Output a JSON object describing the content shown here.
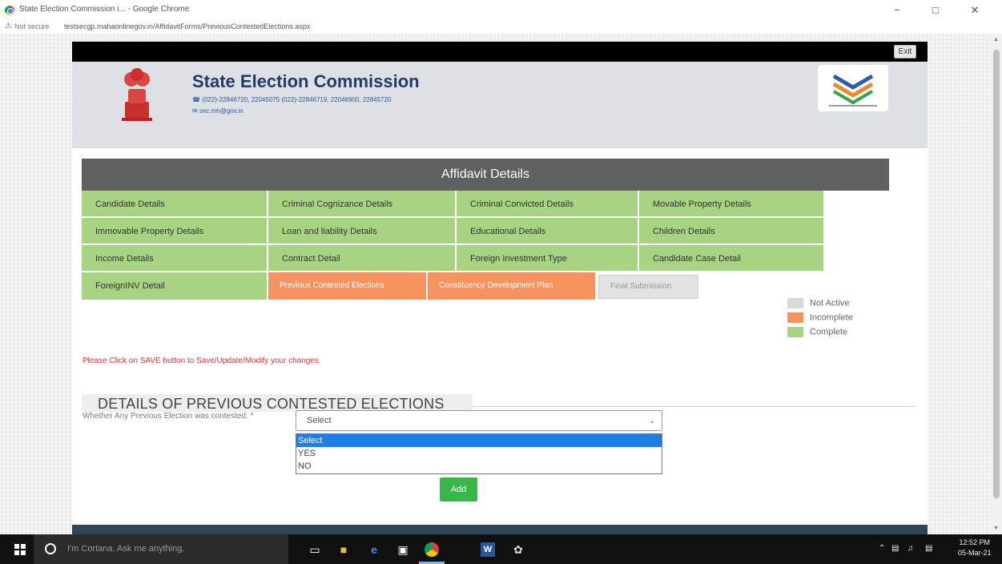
{
  "browser": {
    "window_title": "State Election Commission i... - Google Chrome",
    "not_secure": "Not secure",
    "url": "testsecgp.mahaonlinegov.in/AffidavitForms/PreviousContestedElections.aspx",
    "minimize": "−",
    "maximize": "□",
    "close": "✕"
  },
  "header": {
    "exit_label": "Exit",
    "title": "State Election Commission",
    "phone_text": "☎ (022)-22846720, 22045075   (022)-22846719, 22046900, 22845720",
    "email_text": "✉ sec.mh@gov.in"
  },
  "affidavit": {
    "heading": "Affidavit Details",
    "tiles": [
      {
        "label": "Candidate Details",
        "status": "complete"
      },
      {
        "label": "Criminal Cognizance Details",
        "status": "complete"
      },
      {
        "label": "Criminal Convicted Details",
        "status": "complete"
      },
      {
        "label": "Movable Property Details",
        "status": "complete"
      },
      {
        "label": "Immovable Property Details",
        "status": "complete"
      },
      {
        "label": "Loan and liability Details",
        "status": "complete"
      },
      {
        "label": "Educational Details",
        "status": "complete"
      },
      {
        "label": "Children Details",
        "status": "complete"
      },
      {
        "label": "Income Details",
        "status": "complete"
      },
      {
        "label": "Contract Detail",
        "status": "complete"
      },
      {
        "label": "Foreign Investment Type",
        "status": "complete"
      },
      {
        "label": "Candidate Case Detail",
        "status": "complete"
      },
      {
        "label": "ForeignINV Detail",
        "status": "complete"
      },
      {
        "label": "Previous Contested Elections",
        "status": "incomplete"
      },
      {
        "label": "Constituency Development Plan",
        "status": "incomplete"
      },
      {
        "label": "Final Submission",
        "status": "notactive"
      }
    ],
    "legend": [
      {
        "label": "Not Active",
        "color": "#d9d9d9"
      },
      {
        "label": "Incomplete",
        "color": "#f4935e"
      },
      {
        "label": "Complete",
        "color": "#a7d382"
      }
    ]
  },
  "notice": "Please Click on SAVE button to Save/Update/Modify your changes.",
  "form": {
    "section_title": "DETAILS OF PREVIOUS CONTESTED ELECTIONS",
    "field_label": "Whether Any Previous Election was contested: *",
    "select_value": "Select",
    "options": [
      "Select",
      "YES",
      "NO"
    ],
    "add_label": "Add"
  },
  "taskbar": {
    "cortana_placeholder": "I'm Cortana. Ask me anything.",
    "time": "12:52 PM",
    "date": "05-Mar-21"
  }
}
